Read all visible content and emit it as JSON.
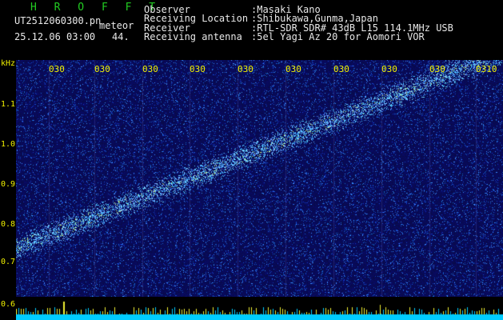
{
  "header": {
    "logo": "H R O F F T",
    "file_name": "UT2512060300.pn",
    "category": "meteor",
    "datetime": "25.12.06 03:00",
    "count": "44.",
    "info_labels": [
      "Observer",
      "Receiving Location",
      "Receiver",
      "Receiving antenna"
    ],
    "info_values": [
      ":Masaki Kano",
      ":Shibukawa,Gunma,Japan",
      ":RTL-SDR SDR# 43dB L15 114.1MHz USB",
      ":5el Yagi Az 20 for Aomori VOR"
    ]
  },
  "axis": {
    "y_unit": "kHz",
    "y_ticks": [
      "1.1",
      "1.0",
      "0.9",
      "0.8",
      "0.7",
      "0.6"
    ],
    "x_ticks": [
      "030",
      "030",
      "030",
      "030",
      "030",
      "030",
      "030",
      "030",
      "030",
      "0310"
    ]
  },
  "colors": {
    "background": "#000000",
    "waterfall": "#0a0a5a",
    "tick_text": "#f0f000",
    "logo": "#22cc22",
    "info_text": "#e8e8e8",
    "signal_trace": "#66ddff",
    "bottom_bar": "#00ccff"
  }
}
